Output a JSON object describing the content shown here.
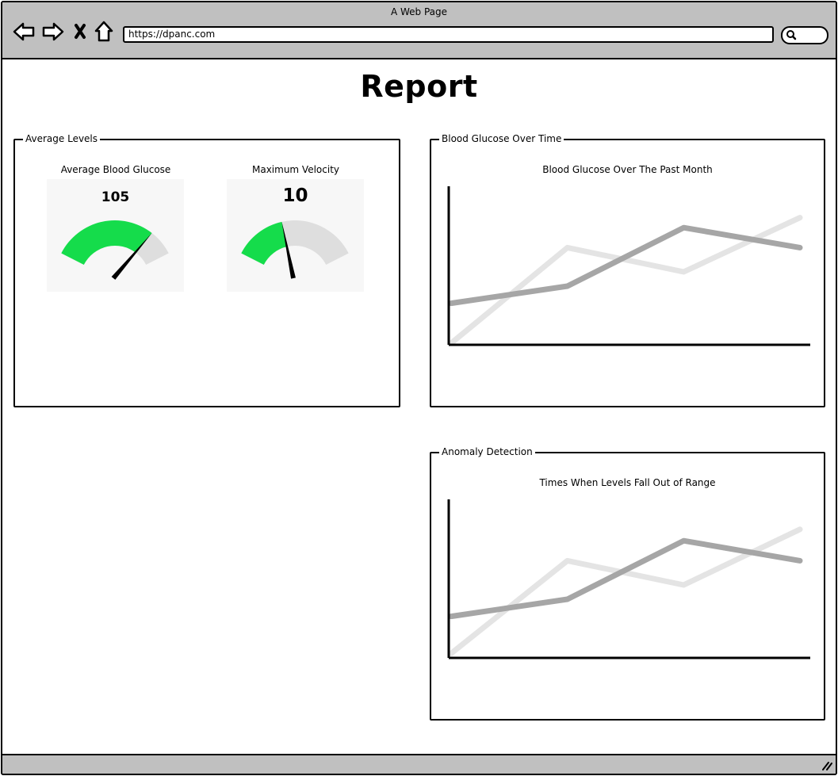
{
  "window": {
    "title": "A Web Page",
    "url": "https://dpanc.com",
    "icons": [
      "back-icon",
      "forward-icon",
      "close-icon",
      "home-icon",
      "search-icon",
      "resize-grip-icon"
    ]
  },
  "page": {
    "title": "Report"
  },
  "average_levels": {
    "legend": "Average Levels",
    "gauges": [
      {
        "label": "Average Blood Glucose",
        "value": "105",
        "level": 0.8,
        "accent": "#15dc4b"
      },
      {
        "label": "Maximum Velocity",
        "value": "10",
        "level": 0.4,
        "accent": "#15dc4b"
      }
    ]
  },
  "glucose_over_time": {
    "legend": "Blood Glucose Over Time",
    "chart_title": "Blood Glucose Over The Past Month"
  },
  "anomaly_detection": {
    "legend": "Anomaly Detection",
    "chart_title": "Times When Levels Fall Out of Range"
  },
  "chart_data": [
    {
      "type": "line",
      "title": "Blood Glucose Over The Past Month",
      "x": [
        0,
        1,
        2,
        3
      ],
      "ylim": [
        0,
        100
      ],
      "series": [
        {
          "values": [
            0,
            67,
            50,
            88
          ],
          "color": "#e4e4e4"
        },
        {
          "values": [
            28,
            40,
            81,
            67
          ],
          "color": "#a6a6a6"
        }
      ]
    },
    {
      "type": "line",
      "title": "Times When Levels Fall Out of Range",
      "x": [
        0,
        1,
        2,
        3
      ],
      "ylim": [
        0,
        100
      ],
      "series": [
        {
          "values": [
            2,
            67,
            50,
            89
          ],
          "color": "#e4e4e4"
        },
        {
          "values": [
            28,
            40,
            81,
            67
          ],
          "color": "#a6a6a6"
        }
      ]
    }
  ]
}
